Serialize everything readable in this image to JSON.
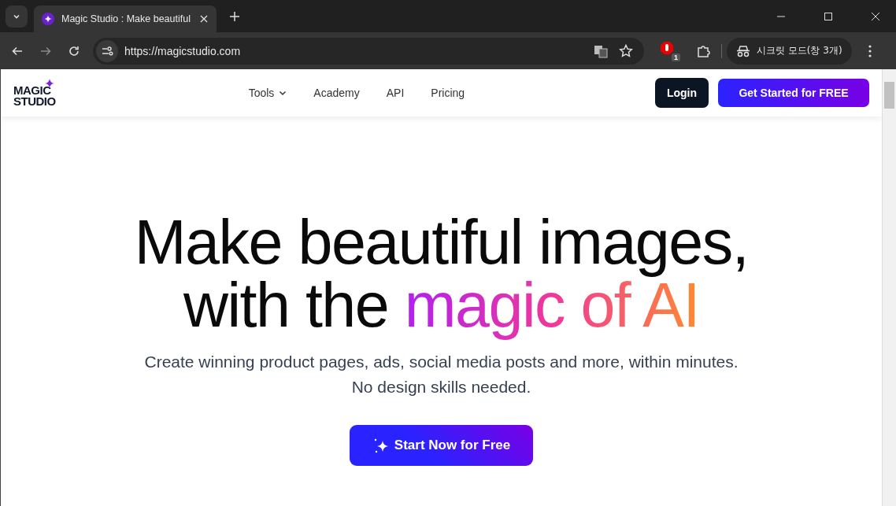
{
  "browser": {
    "tab": {
      "title": "Magic Studio : Make beautiful"
    },
    "url": "https://magicstudio.com",
    "extension_badge": "1",
    "incognito_label": "시크릿 모드(창 3개)"
  },
  "header": {
    "logo_lines": [
      "MAGIC",
      "STUDIO"
    ],
    "nav": [
      {
        "label": "Tools",
        "kind": "dropdown"
      },
      {
        "label": "Academy",
        "kind": "link"
      },
      {
        "label": "API",
        "kind": "link"
      },
      {
        "label": "Pricing",
        "kind": "link"
      }
    ],
    "login": "Login",
    "cta": "Get Started for FREE"
  },
  "hero": {
    "headline_line1": "Make beautiful images,",
    "headline_line2": "with the ",
    "headline_highlight": "magic of AI",
    "subtitle_line1": "Create winning product pages, ads, social media posts and more, within minutes.",
    "subtitle_line2": "No design skills needed.",
    "cta": "Start Now for Free"
  }
}
